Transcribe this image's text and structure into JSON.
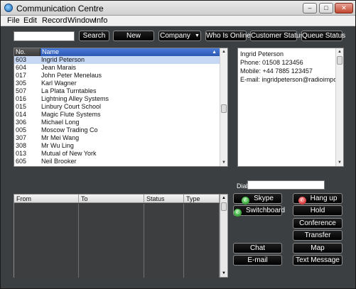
{
  "window": {
    "title": "Communication Centre",
    "controls": {
      "minimize": "–",
      "maximize": "□",
      "close": "✕"
    }
  },
  "menu": [
    "File",
    "Edit",
    "Record",
    "Window",
    "Info"
  ],
  "toolbar": {
    "search_value": "",
    "search_label": "Search",
    "new_label": "New",
    "company_label": "Company",
    "who_is_online_label": "Who Is Online",
    "customer_status_label": "Customer Status",
    "queue_status_label": "Queue Status"
  },
  "contacts": {
    "headers": {
      "no": "No.",
      "name": "Name"
    },
    "rows": [
      {
        "no": "603",
        "name": "Ingrid Peterson"
      },
      {
        "no": "604",
        "name": "Jean Marais"
      },
      {
        "no": "017",
        "name": "John Peter Menelaus"
      },
      {
        "no": "305",
        "name": "Karl Wagner"
      },
      {
        "no": "507",
        "name": "La Plata Turntables"
      },
      {
        "no": "016",
        "name": "Lightning Alley Systems"
      },
      {
        "no": "015",
        "name": "Linbury Court School"
      },
      {
        "no": "014",
        "name": "Magic Flute Systems"
      },
      {
        "no": "306",
        "name": "Michael Long"
      },
      {
        "no": "005",
        "name": "Moscow Trading Co"
      },
      {
        "no": "307",
        "name": "Mr Mei Wang"
      },
      {
        "no": "308",
        "name": "Mr Wu Ling"
      },
      {
        "no": "013",
        "name": "Mutual of New York"
      },
      {
        "no": "605",
        "name": "Neil Brooker"
      }
    ]
  },
  "detail": {
    "name": "Ingrid Peterson",
    "phone": "Phone:  01508 123456",
    "mobile": "Mobile:  +44 7885 123457",
    "email": "E-mail:  ingridpeterson@radioimporte..."
  },
  "dial": {
    "label": "Dial",
    "value": ""
  },
  "calls": {
    "headers": {
      "from": "From",
      "to": "To",
      "status": "Status",
      "type": "Type"
    }
  },
  "actions": {
    "skype": "Skype",
    "hang_up": "Hang up",
    "switchboard": "Switchboard",
    "hold": "Hold",
    "conference": "Conference",
    "transfer": "Transfer",
    "chat": "Chat",
    "map": "Map",
    "email": "E-mail",
    "text_message": "Text Message"
  },
  "colors": {
    "selection": "#c7d8f5",
    "header_active": "#2b57b0",
    "button_bg": "#000000",
    "window_bg": "#3c3f41"
  }
}
